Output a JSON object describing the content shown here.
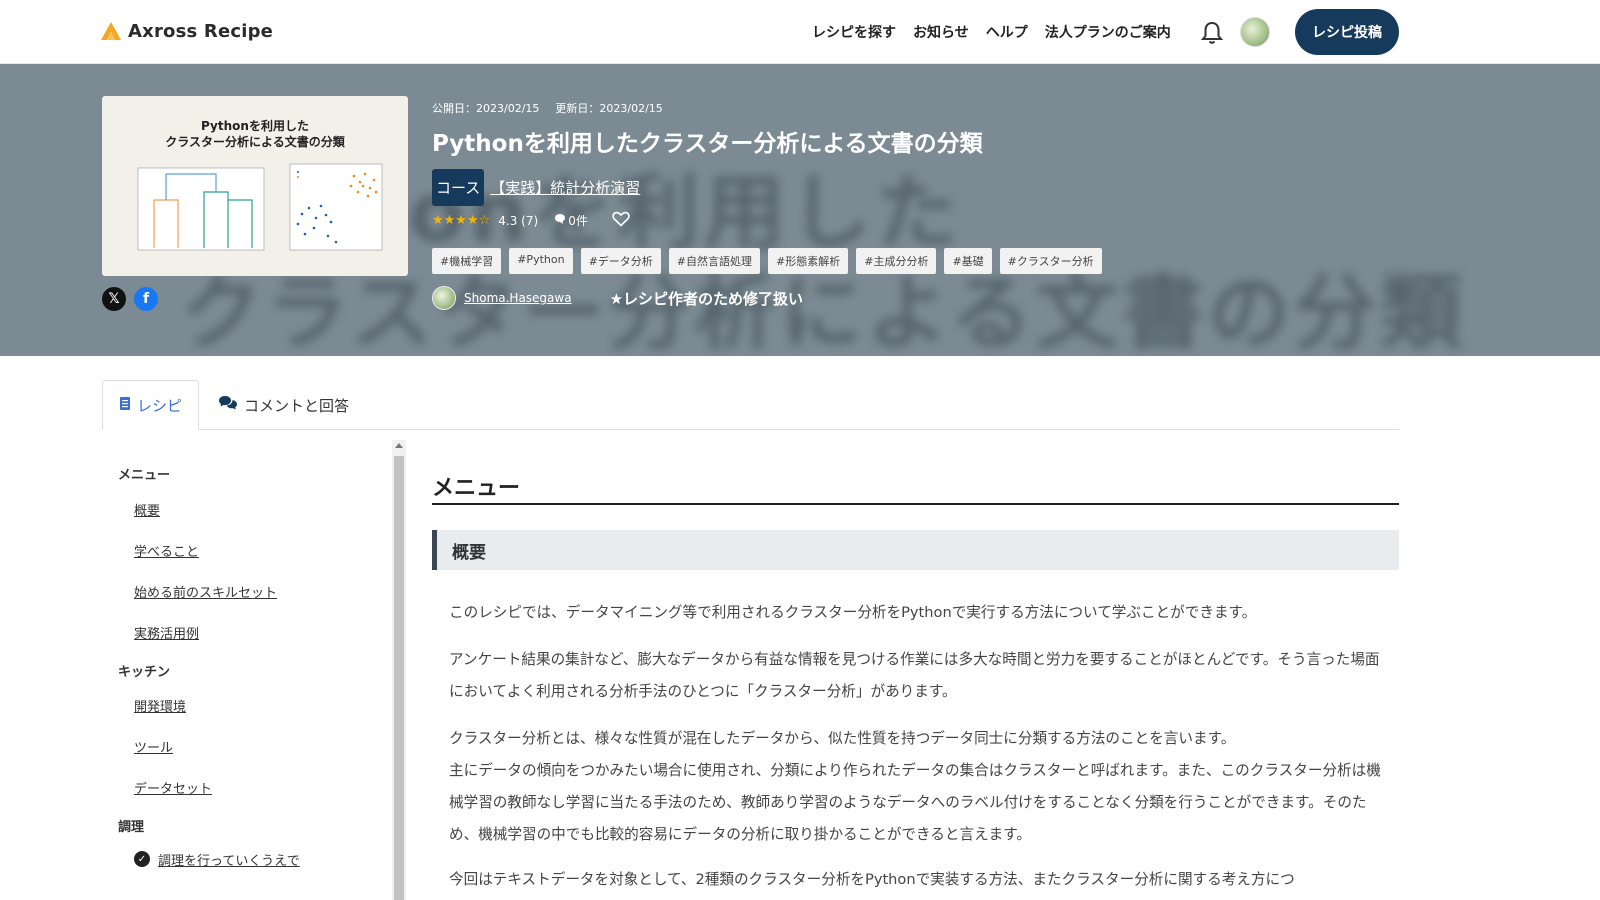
{
  "header": {
    "logo_text": "Axross Recipe",
    "nav": [
      "レシピを探す",
      "お知らせ",
      "ヘルプ",
      "法人プランのご案内"
    ],
    "post_button": "レシピ投稿"
  },
  "hero": {
    "published": "公開日：2023/02/15",
    "updated": "更新日：2023/02/15",
    "title": "Pythonを利用したクラスター分析による文書の分類",
    "thumb_title_line1": "Pythonを利用した",
    "thumb_title_line2": "クラスター分析による文書の分類",
    "course_badge": "コース",
    "course_link": "【実践】統計分析演習",
    "rating": "4.3 (7)",
    "comments": "0件",
    "tags": [
      "#機械学習",
      "#Python",
      "#データ分析",
      "#自然言語処理",
      "#形態素解析",
      "#主成分分析",
      "#基礎",
      "#クラスター分析"
    ],
    "author": "Shoma.Hasegawa",
    "author_note": "★レシピ作者のため修了扱い"
  },
  "tabs": {
    "recipe": "レシピ",
    "comments": "コメントと回答"
  },
  "sidebar": {
    "menu_title": "メニュー",
    "menu_items": [
      "概要",
      "学べること",
      "始める前のスキルセット",
      "実務活用例"
    ],
    "kitchen_title": "キッチン",
    "kitchen_items": [
      "開発環境",
      "ツール",
      "データセット"
    ],
    "cook_title": "調理",
    "cook_items": [
      "調理を行っていくうえで"
    ]
  },
  "main": {
    "heading": "メニュー",
    "sub_heading": "概要",
    "paragraphs": [
      "このレシピでは、データマイニング等で利用されるクラスター分析をPythonで実行する方法について学ぶことができます。",
      "アンケート結果の集計など、膨大なデータから有益な情報を見つける作業には多大な時間と労力を要することがほとんどです。そう言った場面においてよく利用される分析手法のひとつに「クラスター分析」があります。",
      "クラスター分析とは、様々な性質が混在したデータから、似た性質を持つデータ同士に分類する方法のことを言います。",
      "主にデータの傾向をつかみたい場合に使用され、分類により作られたデータの集合はクラスターと呼ばれます。また、このクラスター分析は機械学習の教師なし学習に当たる手法のため、教師あり学習のようなデータへのラベル付けをすることなく分類を行うことができます。そのため、機械学習の中でも比較的容易にデータの分析に取り掛かることができると言えます。",
      "今回はテキストデータを対象として、2種類のクラスター分析をPythonで実装する方法、またクラスター分析に関する考え方につ"
    ]
  },
  "colors": {
    "brand": "#163a5c",
    "hero_bg": "#7c8a93",
    "accent": "#3b6fd8",
    "star": "#f5b400",
    "logo": "#f5a623"
  }
}
